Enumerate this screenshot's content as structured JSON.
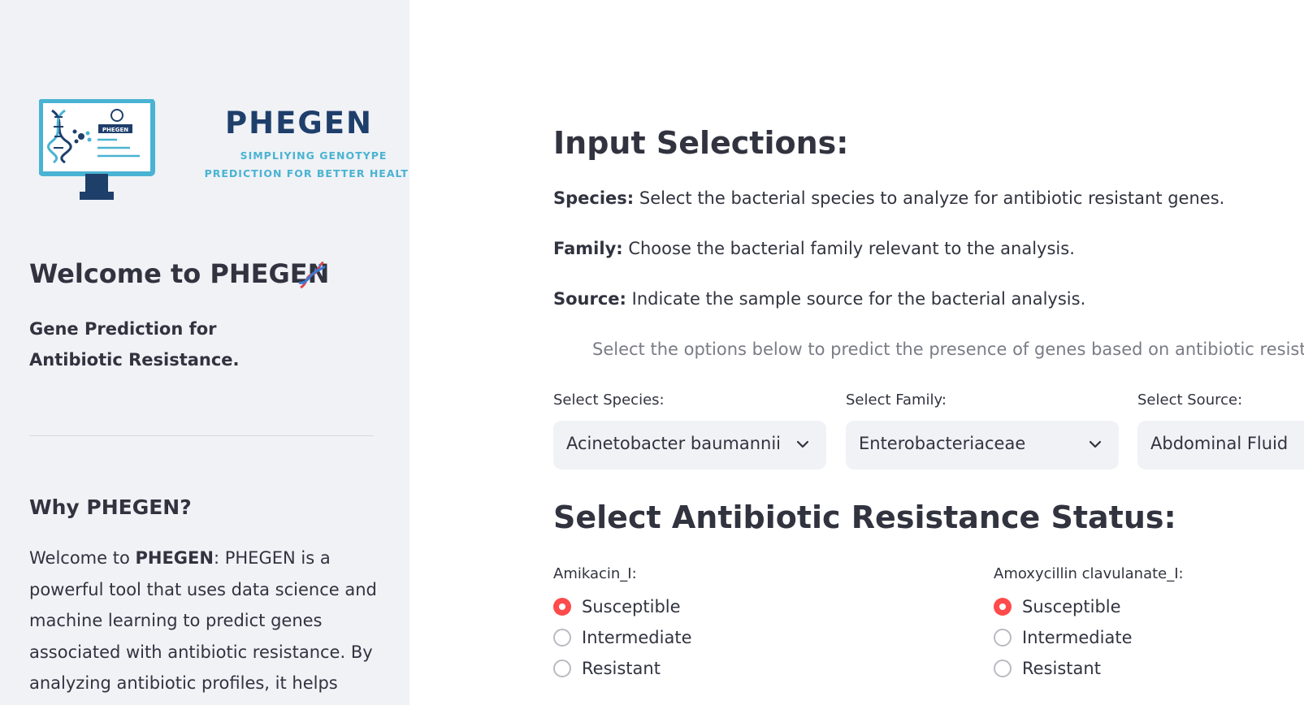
{
  "sidebar": {
    "logo": {
      "brand": "PHEGEN",
      "tagline_line1": "SIMPLIYING GENOTYPE",
      "tagline_line2": "PREDICTION FOR BETTER HEALTH",
      "screen_badge": "PHEGEN"
    },
    "welcome_title": "Welcome to PHEGEN",
    "title_emoji": "dna-icon",
    "subtitle": "Gene Prediction for Antibiotic Resistance.",
    "why_title": "Why PHEGEN?",
    "why_intro": "Welcome to ",
    "why_bold": "PHEGEN",
    "why_body": ": PHEGEN is a powerful tool that uses data science and machine learning to predict genes associated with antibiotic resistance. By analyzing antibiotic profiles, it helps users"
  },
  "main": {
    "input_heading": "Input Selections:",
    "descriptions": [
      {
        "label": "Species:",
        "text": " Select the bacterial species to analyze for antibiotic resistant genes."
      },
      {
        "label": "Family:",
        "text": " Choose the bacterial family relevant to the analysis."
      },
      {
        "label": "Source:",
        "text": " Indicate the sample source for the bacterial analysis."
      }
    ],
    "hint": "Select the options below to predict the presence of genes based on antibiotic resistance",
    "selects": [
      {
        "label": "Select Species:",
        "value": "Acinetobacter baumannii"
      },
      {
        "label": "Select Family:",
        "value": "Enterobacteriaceae"
      },
      {
        "label": "Select Source:",
        "value": "Abdominal Fluid"
      }
    ],
    "status_heading": "Select Antibiotic Resistance Status:",
    "radio_groups": [
      {
        "label": "Amikacin_I:",
        "options": [
          "Susceptible",
          "Intermediate",
          "Resistant"
        ],
        "selected": "Susceptible"
      },
      {
        "label": "Amoxycillin clavulanate_I:",
        "options": [
          "Susceptible",
          "Intermediate",
          "Resistant"
        ],
        "selected": "Susceptible"
      }
    ]
  },
  "colors": {
    "accent": "#FF4B4B",
    "sidebar_bg": "#F0F2F6",
    "brand_navy": "#1F3F6B",
    "brand_cyan": "#4AB3D3"
  }
}
